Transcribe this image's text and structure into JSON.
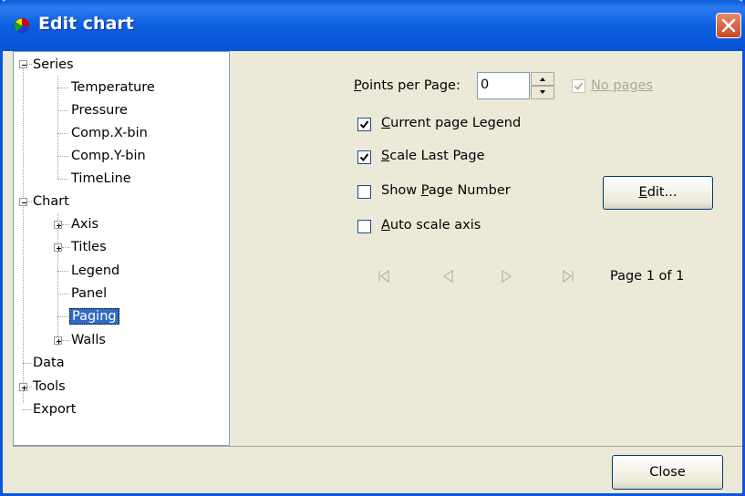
{
  "window": {
    "title": "Edit chart"
  },
  "tree": {
    "series": "Series",
    "series_items": [
      "Temperature",
      "Pressure",
      "Comp.X-bin",
      "Comp.Y-bin",
      "TimeLine"
    ],
    "chart": "Chart",
    "chart_items": [
      "Axis",
      "Titles",
      "Legend",
      "Panel",
      "Paging",
      "Walls"
    ],
    "data": "Data",
    "tools": "Tools",
    "export": "Export"
  },
  "paging": {
    "points_per_page_label": "Points per Page:",
    "points_per_page_value": "0",
    "no_pages_label": "No pages",
    "current_page_legend_label": "Current page Legend",
    "scale_last_page_label": "Scale Last Page",
    "show_page_number_label": "Show Page Number",
    "auto_scale_axis_label": "Auto scale axis",
    "edit_button": "Edit...",
    "page_indicator": "Page 1 of 1"
  },
  "footer": {
    "close_button": "Close"
  },
  "colors": {
    "title_bar": "#0a5ad8",
    "selection": "#316ac5",
    "panel_bg": "#ece9d8"
  }
}
